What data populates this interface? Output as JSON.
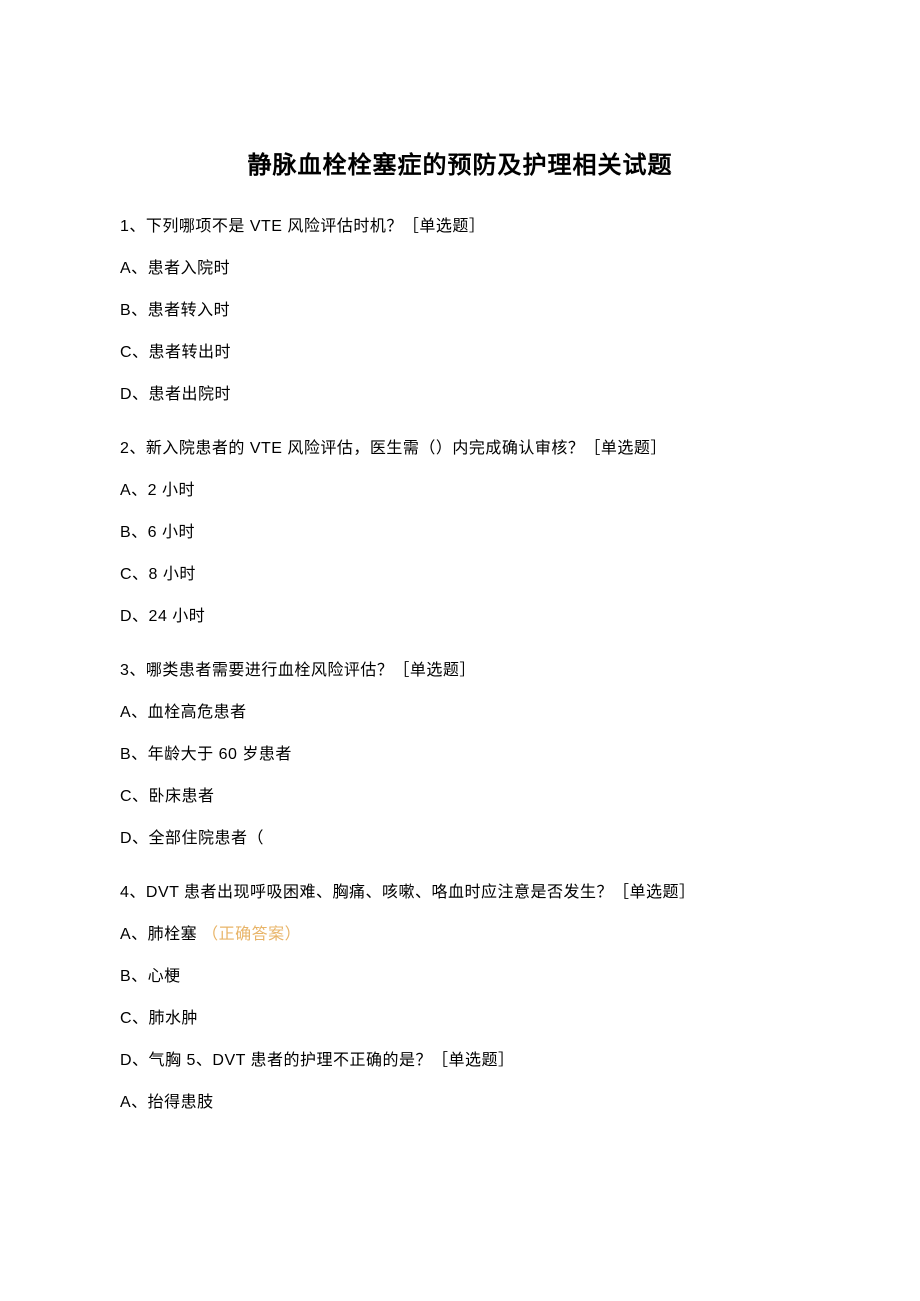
{
  "title": "静脉血栓栓塞症的预防及护理相关试题",
  "q1": {
    "stem": "1、下列哪项不是 VTE 风险评估时机？［单选题］",
    "a": "A、患者入院时",
    "b": "B、患者转入时",
    "c": "C、患者转出时",
    "d": "D、患者出院时"
  },
  "q2": {
    "stem": "2、新入院患者的 VTE 风险评估，医生需（）内完成确认审核？［单选题］",
    "a": "A、2 小时",
    "b": "B、6 小时",
    "c": "C、8 小时",
    "d": "D、24 小时"
  },
  "q3": {
    "stem": "3、哪类患者需要进行血栓风险评估？［单选题］",
    "a": "A、血栓高危患者",
    "b": "B、年龄大于 60 岁患者",
    "c": "C、卧床患者",
    "d": "D、全部住院患者（"
  },
  "q4": {
    "stem": "4、DVT 患者出现呼吸困难、胸痛、咳嗽、咯血时应注意是否发生？［单选题］",
    "a": "A、肺栓塞",
    "a_ans": "（正确答案）",
    "b": "B、心梗",
    "c": "C、肺水肿",
    "d": "D、气胸 5、DVT 患者的护理不正确的是？［单选题］",
    "e": "A、抬得患肢"
  }
}
